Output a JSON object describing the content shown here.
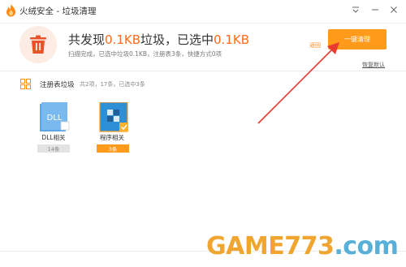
{
  "window": {
    "app_title": "火绒安全 - 垃圾清理",
    "icons": [
      "flame-logo-icon",
      "menu-icon",
      "minimize-icon",
      "close-icon"
    ]
  },
  "summary": {
    "head_prefix": "共发现",
    "found_size": "0.1KB",
    "head_mid": "垃圾，已选中",
    "selected_size": "0.1KB",
    "subtitle": "扫描完成，已选中垃圾0.1KB，注册表3条，快捷方式0项",
    "back_link": "返回",
    "clean_button": "一键清理",
    "restore_link": "恢复默认",
    "accent_color": "#ff6a1a",
    "button_color": "#ff9a1a"
  },
  "section": {
    "title": "注册表垃圾",
    "meta": "共2项，17条，已选中3条"
  },
  "items": [
    {
      "label": "DLL相关",
      "count": "14条",
      "selected": false,
      "icon_text": "DLL"
    },
    {
      "label": "程序相关",
      "count": "3条",
      "selected": true,
      "icon_text": ""
    }
  ],
  "watermark": {
    "game": "GAME",
    "number": "773",
    "dot": ".",
    "domain": "com"
  }
}
